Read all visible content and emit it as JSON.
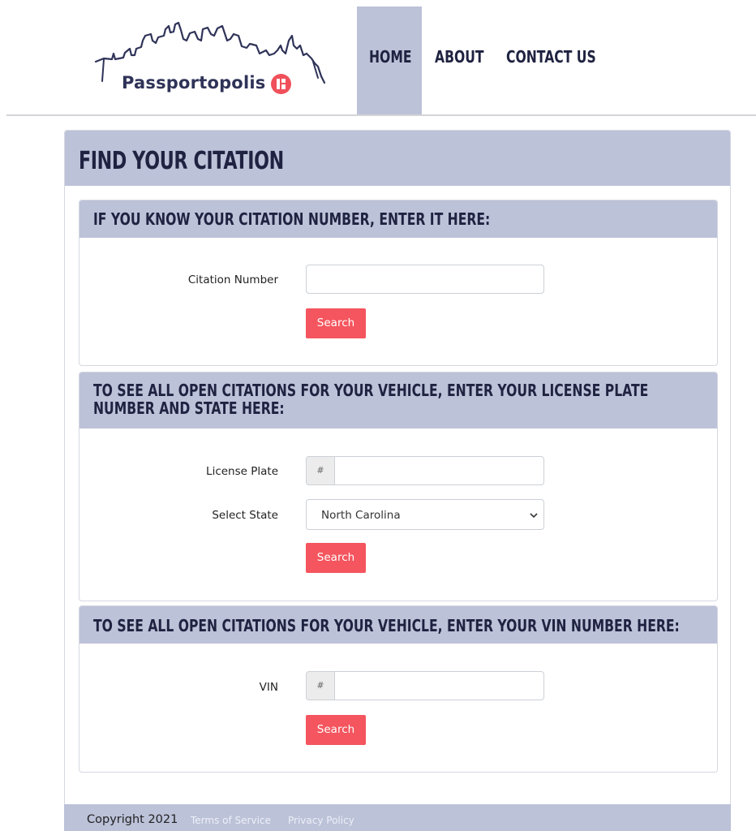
{
  "brand": {
    "name": "Passportopolis",
    "logo_icon": "city-skyline-logo"
  },
  "nav": {
    "items": [
      {
        "label": "HOME",
        "active": true
      },
      {
        "label": "ABOUT",
        "active": false
      },
      {
        "label": "CONTACT US",
        "active": false
      }
    ]
  },
  "page": {
    "title": "FIND YOUR CITATION"
  },
  "panels": {
    "citation": {
      "heading": "IF YOU KNOW YOUR CITATION NUMBER, ENTER IT HERE:",
      "field_label": "Citation Number",
      "value": "",
      "button": "Search"
    },
    "plate": {
      "heading": "TO SEE ALL OPEN CITATIONS FOR YOUR VEHICLE, ENTER YOUR LICENSE PLATE NUMBER AND STATE HERE:",
      "plate_label": "License Plate",
      "prefix": "#",
      "plate_value": "",
      "state_label": "Select State",
      "state_value": "North Carolina",
      "button": "Search"
    },
    "vin": {
      "heading": "TO SEE ALL OPEN CITATIONS FOR YOUR VEHICLE, ENTER YOUR VIN NUMBER HERE:",
      "field_label": "VIN",
      "prefix": "#",
      "value": "",
      "button": "Search"
    }
  },
  "footer": {
    "copyright": "Copyright 2021",
    "links": [
      "Terms of Service",
      "Privacy Policy"
    ]
  },
  "colors": {
    "accent": "#bcc2d8",
    "button": "#f4555e",
    "brand_red": "#f0505a",
    "navy": "#1f2240"
  }
}
